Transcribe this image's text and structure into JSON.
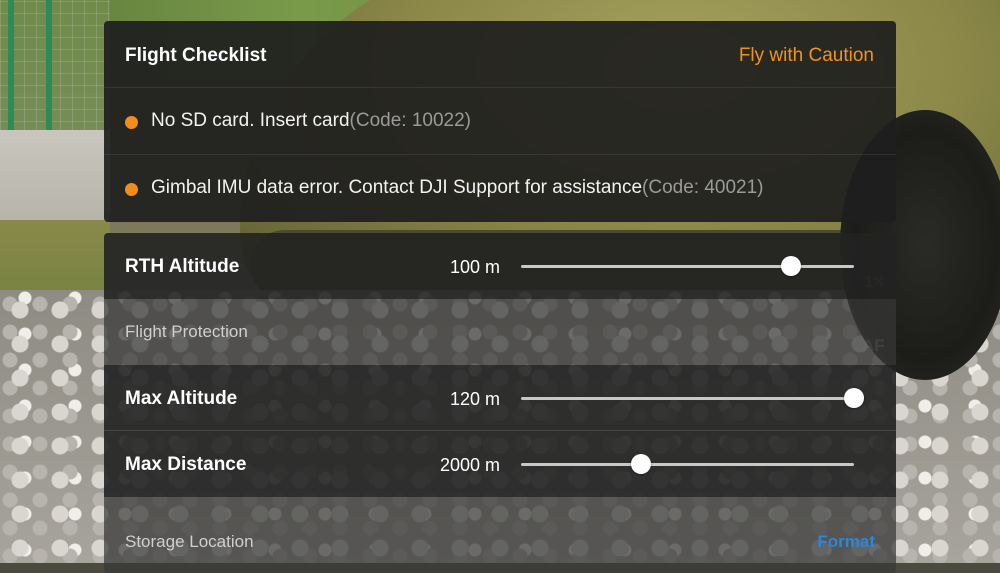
{
  "checklist": {
    "title": "Flight Checklist",
    "status": "Fly with Caution",
    "status_color": "#f0921e",
    "items": [
      {
        "message": "No SD card. Insert card",
        "code": "(Code: 10022)",
        "severity_color": "#f28c1c"
      },
      {
        "message": "Gimbal IMU data error. Contact DJI Support for assistance",
        "code": "(Code: 40021)",
        "severity_color": "#f28c1c"
      }
    ]
  },
  "settings": {
    "rth_altitude": {
      "label": "RTH Altitude",
      "value": "100 m",
      "slider_fraction": 0.81
    },
    "flight_protection": {
      "title": "Flight Protection"
    },
    "max_altitude": {
      "label": "Max Altitude",
      "value": "120 m",
      "slider_fraction": 1.0
    },
    "max_distance": {
      "label": "Max Distance",
      "value": "2000 m",
      "slider_fraction": 0.36
    },
    "storage_location": {
      "title": "Storage Location",
      "format_label": "Format",
      "link_color": "#2b87d8"
    }
  },
  "background_hints": {
    "zoom": "1×",
    "focus": "AF"
  }
}
